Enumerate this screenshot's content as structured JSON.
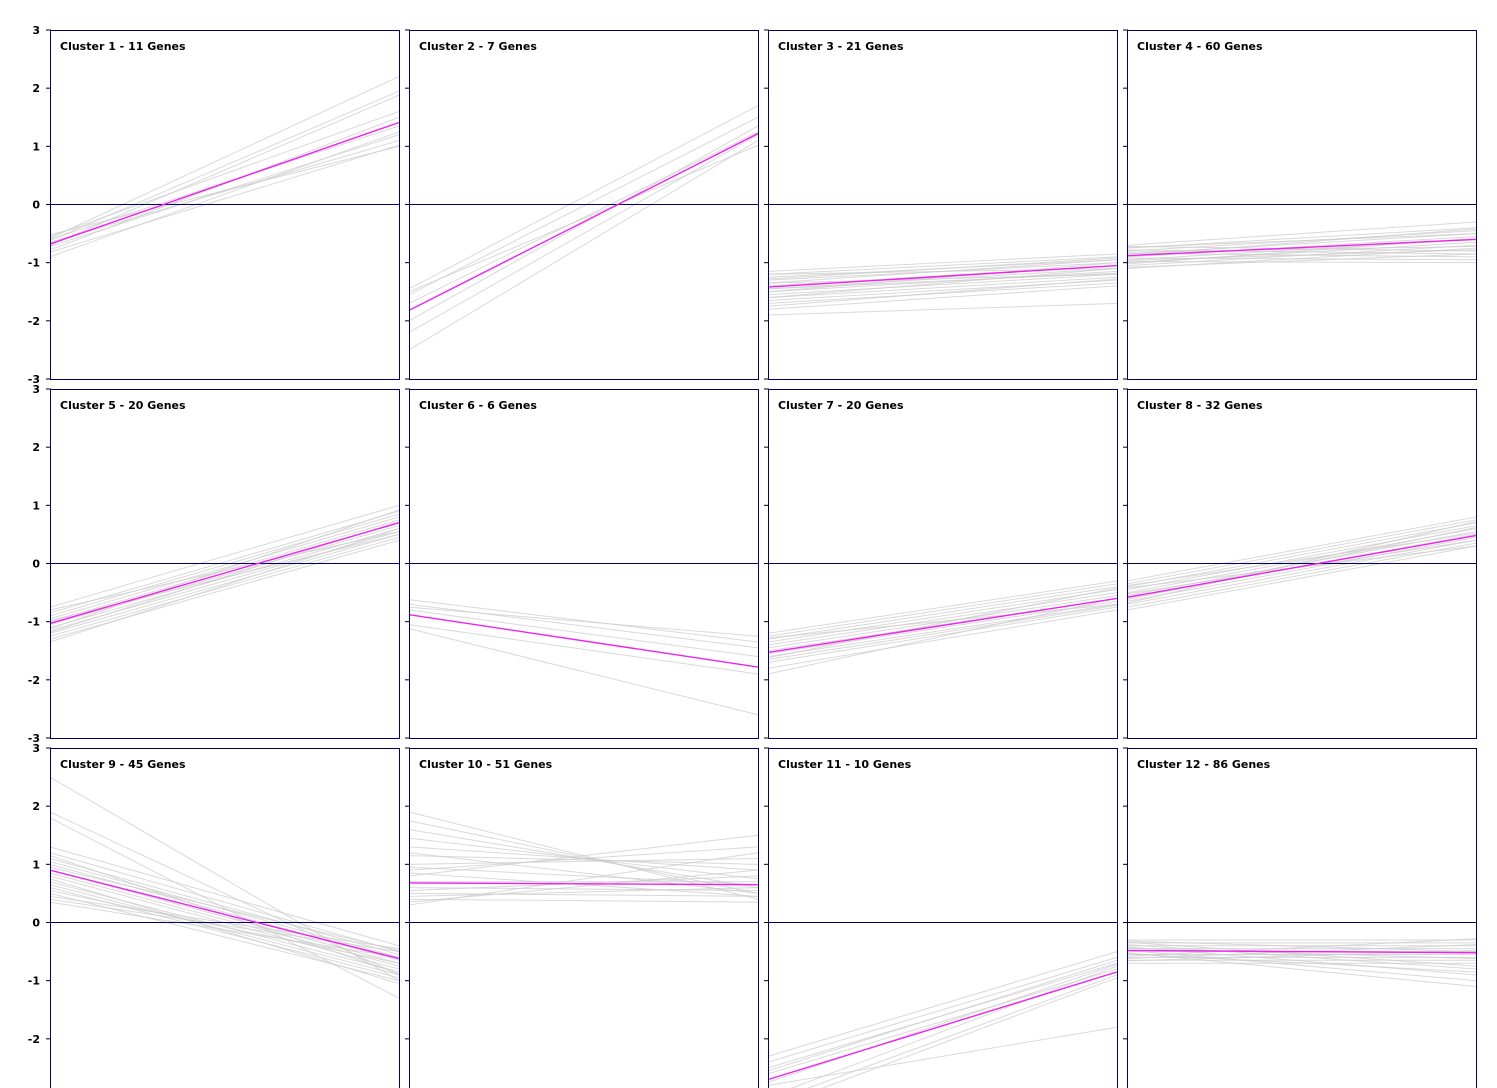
{
  "chart_data": {
    "type": "line",
    "layout": "small-multiples grid, 4 columns x 3 rows",
    "x": [
      0,
      1
    ],
    "ylim": [
      -3,
      3
    ],
    "yticks": [
      "-3",
      "-2",
      "-1",
      "0",
      "1",
      "2",
      "3"
    ],
    "grid": false,
    "zero_line": true,
    "colors": {
      "gene_line": "#cccccc",
      "centroid_line": "#ee22ee",
      "frame": "#000066",
      "zero_line": "#000066"
    },
    "panels": [
      {
        "title": "Cluster 1 - 11 Genes",
        "centroid": [
          -0.68,
          1.41
        ],
        "genes": [
          [
            -0.58,
            2.2
          ],
          [
            -0.62,
            1.95
          ],
          [
            -0.7,
            1.88
          ],
          [
            -0.55,
            1.6
          ],
          [
            -0.78,
            1.5
          ],
          [
            -0.6,
            1.35
          ],
          [
            -0.9,
            1.25
          ],
          [
            -0.72,
            1.2
          ],
          [
            -0.65,
            1.1
          ],
          [
            -0.52,
            1.0
          ],
          [
            -0.82,
            1.02
          ]
        ]
      },
      {
        "title": "Cluster 2 - 7 Genes",
        "centroid": [
          -1.82,
          1.22
        ],
        "genes": [
          [
            -1.45,
            1.7
          ],
          [
            -1.55,
            1.5
          ],
          [
            -2.0,
            1.35
          ],
          [
            -2.2,
            1.2
          ],
          [
            -2.5,
            1.1
          ],
          [
            -1.5,
            1.02
          ],
          [
            -1.7,
            1.25
          ]
        ]
      },
      {
        "title": "Cluster 3 - 21 Genes",
        "centroid": [
          -1.42,
          -1.05
        ],
        "genes": [
          [
            -1.15,
            -0.85
          ],
          [
            -1.2,
            -0.9
          ],
          [
            -1.25,
            -0.95
          ],
          [
            -1.3,
            -1.0
          ],
          [
            -1.35,
            -0.95
          ],
          [
            -1.4,
            -1.05
          ],
          [
            -1.45,
            -1.1
          ],
          [
            -1.5,
            -1.15
          ],
          [
            -1.55,
            -1.2
          ],
          [
            -1.6,
            -1.25
          ],
          [
            -1.65,
            -1.3
          ],
          [
            -1.7,
            -1.35
          ],
          [
            -1.8,
            -1.4
          ],
          [
            -1.9,
            -1.7
          ],
          [
            -1.2,
            -1.1
          ],
          [
            -1.35,
            -1.2
          ],
          [
            -1.5,
            -1.0
          ],
          [
            -1.6,
            -1.1
          ],
          [
            -1.28,
            -0.92
          ],
          [
            -1.75,
            -1.28
          ],
          [
            -1.45,
            -1.18
          ]
        ]
      },
      {
        "title": "Cluster 4 - 60 Genes",
        "centroid": [
          -0.88,
          -0.6
        ],
        "genes": [
          [
            -0.7,
            -0.3
          ],
          [
            -0.75,
            -0.4
          ],
          [
            -0.8,
            -0.45
          ],
          [
            -0.85,
            -0.5
          ],
          [
            -0.9,
            -0.55
          ],
          [
            -0.95,
            -0.6
          ],
          [
            -1.0,
            -0.65
          ],
          [
            -1.05,
            -0.7
          ],
          [
            -1.1,
            -0.75
          ],
          [
            -0.72,
            -0.8
          ],
          [
            -0.78,
            -0.85
          ],
          [
            -0.84,
            -0.9
          ],
          [
            -0.92,
            -0.95
          ],
          [
            -0.98,
            -1.0
          ],
          [
            -1.08,
            -0.85
          ],
          [
            -0.74,
            -0.5
          ],
          [
            -0.88,
            -0.42
          ],
          [
            -1.02,
            -0.58
          ],
          [
            -0.82,
            -0.72
          ],
          [
            -0.96,
            -0.78
          ]
        ]
      },
      {
        "title": "Cluster 5 - 20 Genes",
        "centroid": [
          -1.03,
          0.7
        ],
        "genes": [
          [
            -0.75,
            1.0
          ],
          [
            -0.85,
            0.9
          ],
          [
            -0.9,
            0.85
          ],
          [
            -0.95,
            0.8
          ],
          [
            -1.0,
            0.75
          ],
          [
            -1.05,
            0.65
          ],
          [
            -1.1,
            0.6
          ],
          [
            -1.15,
            0.55
          ],
          [
            -1.2,
            0.5
          ],
          [
            -1.25,
            0.45
          ],
          [
            -1.3,
            0.4
          ],
          [
            -1.35,
            0.6
          ],
          [
            -0.8,
            0.55
          ],
          [
            -1.12,
            0.92
          ],
          [
            -0.98,
            0.5
          ],
          [
            -1.18,
            0.72
          ]
        ]
      },
      {
        "title": "Cluster 6 - 6 Genes",
        "centroid": [
          -0.88,
          -1.78
        ],
        "genes": [
          [
            -0.62,
            -1.35
          ],
          [
            -0.7,
            -1.45
          ],
          [
            -0.8,
            -1.6
          ],
          [
            -1.05,
            -1.9
          ],
          [
            -1.12,
            -2.6
          ],
          [
            -0.75,
            -1.25
          ]
        ]
      },
      {
        "title": "Cluster 7 - 20 Genes",
        "centroid": [
          -1.53,
          -0.6
        ],
        "genes": [
          [
            -1.2,
            -0.3
          ],
          [
            -1.25,
            -0.35
          ],
          [
            -1.3,
            -0.4
          ],
          [
            -1.35,
            -0.45
          ],
          [
            -1.4,
            -0.5
          ],
          [
            -1.45,
            -0.55
          ],
          [
            -1.5,
            -0.6
          ],
          [
            -1.55,
            -0.65
          ],
          [
            -1.6,
            -0.7
          ],
          [
            -1.65,
            -0.72
          ],
          [
            -1.7,
            -0.75
          ],
          [
            -1.8,
            -0.8
          ],
          [
            -1.9,
            -0.6
          ],
          [
            -1.28,
            -0.7
          ],
          [
            -1.62,
            -0.42
          ]
        ]
      },
      {
        "title": "Cluster 8 - 32 Genes",
        "centroid": [
          -0.58,
          0.48
        ],
        "genes": [
          [
            -0.3,
            0.8
          ],
          [
            -0.35,
            0.75
          ],
          [
            -0.4,
            0.7
          ],
          [
            -0.45,
            0.65
          ],
          [
            -0.5,
            0.6
          ],
          [
            -0.55,
            0.55
          ],
          [
            -0.6,
            0.5
          ],
          [
            -0.65,
            0.45
          ],
          [
            -0.7,
            0.4
          ],
          [
            -0.75,
            0.35
          ],
          [
            -0.8,
            0.3
          ],
          [
            -0.42,
            0.3
          ],
          [
            -0.68,
            0.72
          ],
          [
            -0.52,
            0.4
          ],
          [
            -0.62,
            0.62
          ],
          [
            -0.38,
            0.52
          ]
        ]
      },
      {
        "title": "Cluster 9 - 45 Genes",
        "centroid": [
          0.9,
          -0.62
        ],
        "genes": [
          [
            2.5,
            -1.0
          ],
          [
            1.9,
            -0.9
          ],
          [
            1.8,
            -1.3
          ],
          [
            1.3,
            -0.4
          ],
          [
            1.2,
            -0.5
          ],
          [
            1.1,
            -0.55
          ],
          [
            1.05,
            -0.6
          ],
          [
            1.0,
            -0.65
          ],
          [
            0.9,
            -0.7
          ],
          [
            0.85,
            -0.75
          ],
          [
            0.8,
            -0.8
          ],
          [
            0.7,
            -0.85
          ],
          [
            0.65,
            -0.9
          ],
          [
            0.6,
            -0.95
          ],
          [
            0.5,
            -1.0
          ],
          [
            0.45,
            -0.45
          ],
          [
            0.4,
            -0.5
          ],
          [
            0.35,
            -0.6
          ],
          [
            0.55,
            -0.7
          ],
          [
            0.75,
            -1.05
          ],
          [
            1.15,
            -0.88
          ],
          [
            0.95,
            -0.48
          ]
        ]
      },
      {
        "title": "Cluster 10 - 51 Genes",
        "centroid": [
          0.68,
          0.65
        ],
        "genes": [
          [
            1.9,
            0.4
          ],
          [
            1.75,
            0.5
          ],
          [
            1.6,
            0.6
          ],
          [
            1.45,
            0.75
          ],
          [
            1.3,
            0.9
          ],
          [
            1.15,
            1.0
          ],
          [
            1.0,
            1.1
          ],
          [
            0.9,
            1.3
          ],
          [
            0.8,
            1.5
          ],
          [
            0.7,
            0.7
          ],
          [
            0.6,
            0.55
          ],
          [
            0.5,
            0.45
          ],
          [
            0.4,
            0.35
          ],
          [
            0.35,
            0.9
          ],
          [
            0.3,
            1.2
          ],
          [
            0.45,
            0.6
          ],
          [
            0.55,
            0.8
          ],
          [
            0.85,
            0.45
          ],
          [
            0.95,
            0.65
          ],
          [
            1.2,
            0.5
          ]
        ]
      },
      {
        "title": "Cluster 11 - 10 Genes",
        "centroid": [
          -2.7,
          -0.85
        ],
        "genes": [
          [
            -2.3,
            -0.5
          ],
          [
            -2.4,
            -0.6
          ],
          [
            -2.5,
            -0.7
          ],
          [
            -2.6,
            -0.8
          ],
          [
            -2.8,
            -1.8
          ],
          [
            -3.0,
            -0.75
          ],
          [
            -3.1,
            -0.9
          ],
          [
            -3.2,
            -0.95
          ],
          [
            -2.55,
            -0.65
          ],
          [
            -2.75,
            -0.72
          ]
        ]
      },
      {
        "title": "Cluster 12 - 86 Genes",
        "centroid": [
          -0.48,
          -0.52
        ],
        "genes": [
          [
            -0.3,
            -0.3
          ],
          [
            -0.35,
            -0.35
          ],
          [
            -0.4,
            -0.4
          ],
          [
            -0.45,
            -0.45
          ],
          [
            -0.5,
            -0.5
          ],
          [
            -0.55,
            -0.55
          ],
          [
            -0.6,
            -0.6
          ],
          [
            -0.65,
            -0.65
          ],
          [
            -0.7,
            -0.7
          ],
          [
            -0.38,
            -0.8
          ],
          [
            -0.42,
            -0.9
          ],
          [
            -0.48,
            -1.0
          ],
          [
            -0.52,
            -1.1
          ],
          [
            -0.58,
            -0.28
          ],
          [
            -0.62,
            -0.38
          ],
          [
            -0.34,
            -0.75
          ],
          [
            -0.44,
            -0.62
          ],
          [
            -0.66,
            -0.48
          ],
          [
            -0.54,
            -0.85
          ],
          [
            -0.32,
            -0.5
          ]
        ]
      }
    ]
  }
}
